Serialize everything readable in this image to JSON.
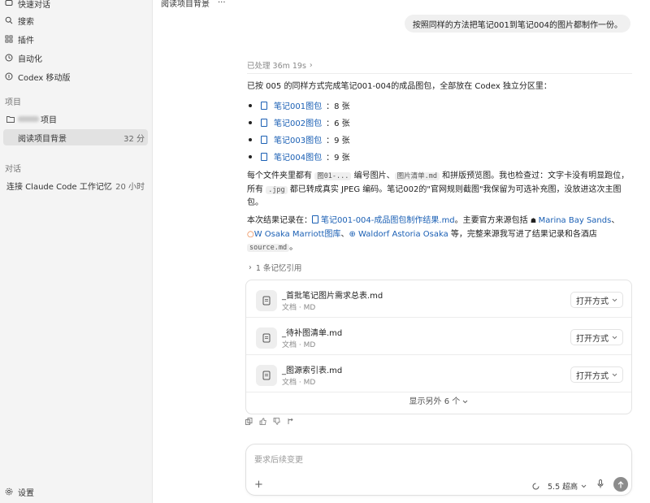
{
  "sidebar": {
    "nav": [
      {
        "label": "快速对话",
        "icon": "chat-icon"
      },
      {
        "label": "搜索",
        "icon": "search-icon"
      },
      {
        "label": "插件",
        "icon": "plugin-icon"
      },
      {
        "label": "自动化",
        "icon": "clock-icon"
      },
      {
        "label": "Codex 移动版",
        "icon": "mobile-icon"
      }
    ],
    "projects_label": "项目",
    "project": {
      "label": "项目"
    },
    "active_thread": {
      "label": "阅读项目背景",
      "time": "32 分"
    },
    "chats_label": "对话",
    "chat": {
      "label": "连接 Claude Code 工作记忆",
      "time": "20 小时"
    },
    "settings_label": "设置"
  },
  "header": {
    "title": "阅读项目背景",
    "more": "···"
  },
  "user_message": "按照同样的方法把笔记001到笔记004的图片都制作一份。",
  "status": {
    "text": "已处理 36m 19s",
    "chevron": "›"
  },
  "intro": "已按 005 的同样方式完成笔记001-004的成品图包，全部放在 Codex 独立分区里：",
  "bullets": [
    {
      "link": "笔记001图包",
      "count": "：8 张"
    },
    {
      "link": "笔记002图包",
      "count": "：6 张"
    },
    {
      "link": "笔记003图包",
      "count": "：9 张"
    },
    {
      "link": "笔记004图包",
      "count": "：9 张"
    }
  ],
  "para2": {
    "t1": "每个文件夹里都有 ",
    "c1": "图01-...",
    "t2": " 编号图片、",
    "c2": "图片清单.md",
    "t3": " 和拼版预览图。我也检查过：文字卡没有明显跑位，所有 ",
    "c3": ".jpg",
    "t4": " 都已转成真实 JPEG 编码。笔记002的\"官网规则截图\"我保留为可选补充图，没放进这次主图包。"
  },
  "para3": {
    "t1": "本次结果记录在：",
    "link1": "笔记001-004-成品图包制作结果.md",
    "t2": "。主要官方来源包括 ",
    "link2": "Marina Bay Sands",
    "t3": "、",
    "link3": "W Osaka Marriott图库",
    "t4": "、",
    "link4": "Waldorf Astoria Osaka",
    "t5": " 等，完整来源我写进了结果记录和各酒店 ",
    "c1": "source.md",
    "t6": "。"
  },
  "memory": {
    "chevron": "›",
    "text": "1 条记忆引用"
  },
  "files": [
    {
      "name": "_首批笔记图片需求总表.md",
      "type": "文档 · MD",
      "open": "打开方式"
    },
    {
      "name": "_待补图清单.md",
      "type": "文档 · MD",
      "open": "打开方式"
    },
    {
      "name": "_图源索引表.md",
      "type": "文档 · MD",
      "open": "打开方式"
    }
  ],
  "show_more": "显示另外 6 个",
  "composer": {
    "placeholder": "要求后续变更",
    "plus": "+",
    "model": "5.5 超高"
  }
}
